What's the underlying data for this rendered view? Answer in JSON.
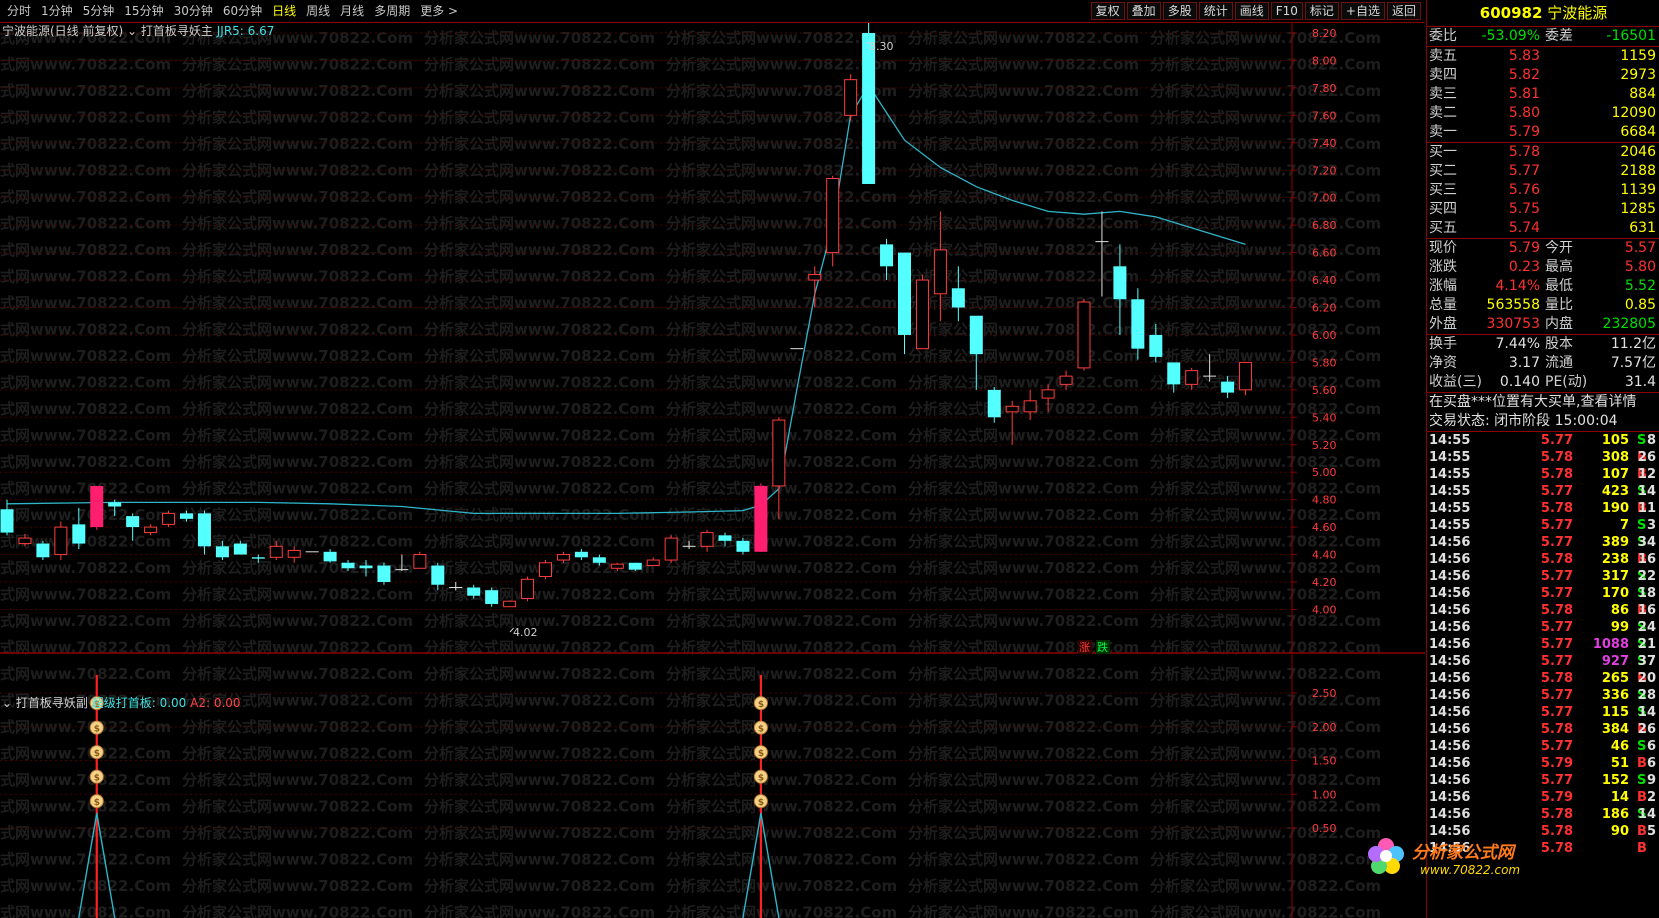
{
  "toolbar": {
    "periods": [
      "分时",
      "1分钟",
      "5分钟",
      "15分钟",
      "30分钟",
      "60分钟",
      "日线",
      "周线",
      "月线",
      "多周期",
      "更多 >"
    ],
    "active_period": "日线",
    "tools": [
      "复权",
      "叠加",
      "多股",
      "统计",
      "画线",
      "F10",
      "标记",
      "+自选",
      "返回"
    ]
  },
  "main_chart": {
    "stock_label": "宁波能源(日线 前复权)",
    "indicator_name": "打首板寻妖主",
    "ma_label": "JJR5: 6.67",
    "y_ticks": [
      "8.20",
      "8.00",
      "7.80",
      "7.60",
      "7.40",
      "7.20",
      "7.00",
      "6.80",
      "6.60",
      "6.40",
      "6.20",
      "6.00",
      "5.80",
      "5.60",
      "5.40",
      "5.20",
      "5.00",
      "4.80",
      "4.60",
      "4.40",
      "4.20",
      "4.00"
    ],
    "high_annotation": "8.30",
    "low_annotation": "4.02",
    "marker_up": "涨",
    "marker_down": "跌"
  },
  "sub_chart": {
    "indicator_name": "打首板寻妖副",
    "line1": "超级打首板: 0.00",
    "line2": "A2: 0.00",
    "y_ticks": [
      "2.50",
      "2.00",
      "1.50",
      "1.00",
      "0.50"
    ]
  },
  "chart_data": {
    "type": "candlestick",
    "ylim": [
      3.95,
      8.35
    ],
    "candles": [
      [
        4.73,
        4.56,
        4.8,
        4.54
      ],
      [
        4.48,
        4.52,
        4.55,
        4.46
      ],
      [
        4.48,
        4.38,
        4.5,
        4.36
      ],
      [
        4.4,
        4.6,
        4.64,
        4.36
      ],
      [
        4.62,
        4.48,
        4.74,
        4.44
      ],
      [
        4.6,
        4.9,
        4.9,
        4.58
      ],
      [
        4.78,
        4.75,
        4.8,
        4.68
      ],
      [
        4.68,
        4.6,
        4.7,
        4.5
      ],
      [
        4.56,
        4.6,
        4.62,
        4.54
      ],
      [
        4.62,
        4.7,
        4.72,
        4.6
      ],
      [
        4.7,
        4.66,
        4.72,
        4.64
      ],
      [
        4.7,
        4.46,
        4.72,
        4.4
      ],
      [
        4.46,
        4.38,
        4.5,
        4.36
      ],
      [
        4.48,
        4.4,
        4.5,
        4.4
      ],
      [
        4.38,
        4.37,
        4.4,
        4.34
      ],
      [
        4.38,
        4.46,
        4.5,
        4.36
      ],
      [
        4.38,
        4.43,
        4.46,
        4.34
      ],
      [
        4.42,
        4.42,
        4.42,
        4.42
      ],
      [
        4.42,
        4.35,
        4.44,
        4.34
      ],
      [
        4.34,
        4.3,
        4.36,
        4.28
      ],
      [
        4.32,
        4.3,
        4.36,
        4.24
      ],
      [
        4.32,
        4.2,
        4.34,
        4.18
      ],
      [
        4.29,
        4.29,
        4.4,
        4.28
      ],
      [
        4.3,
        4.4,
        4.42,
        4.3
      ],
      [
        4.32,
        4.18,
        4.34,
        4.14
      ],
      [
        4.16,
        4.16,
        4.2,
        4.14
      ],
      [
        4.16,
        4.1,
        4.18,
        4.08
      ],
      [
        4.14,
        4.04,
        4.16,
        4.02
      ],
      [
        4.02,
        4.06,
        4.06,
        4.02
      ],
      [
        4.08,
        4.22,
        4.24,
        4.06
      ],
      [
        4.24,
        4.34,
        4.36,
        4.22
      ],
      [
        4.36,
        4.4,
        4.42,
        4.34
      ],
      [
        4.42,
        4.38,
        4.44,
        4.36
      ],
      [
        4.38,
        4.34,
        4.4,
        4.32
      ],
      [
        4.3,
        4.33,
        4.34,
        4.28
      ],
      [
        4.34,
        4.29,
        4.34,
        4.28
      ],
      [
        4.32,
        4.36,
        4.38,
        4.32
      ],
      [
        4.36,
        4.52,
        4.54,
        4.34
      ],
      [
        4.46,
        4.46,
        4.5,
        4.44
      ],
      [
        4.46,
        4.56,
        4.58,
        4.42
      ],
      [
        4.54,
        4.5,
        4.56,
        4.46
      ],
      [
        4.5,
        4.42,
        4.52,
        4.4
      ],
      [
        4.42,
        4.9,
        4.92,
        4.42
      ],
      [
        4.9,
        5.38,
        5.4,
        4.66
      ],
      [
        5.9,
        5.9,
        5.9,
        5.9
      ],
      [
        6.4,
        6.44,
        6.5,
        6.2
      ],
      [
        6.6,
        7.14,
        7.16,
        6.5
      ],
      [
        7.6,
        7.86,
        7.9,
        7.56
      ],
      [
        8.2,
        7.1,
        8.3,
        7.1
      ],
      [
        6.66,
        6.5,
        6.7,
        6.4
      ],
      [
        6.6,
        6.0,
        6.6,
        5.86
      ],
      [
        5.9,
        6.4,
        6.44,
        5.9
      ],
      [
        6.3,
        6.62,
        6.9,
        6.1
      ],
      [
        6.34,
        6.2,
        6.5,
        6.1
      ],
      [
        6.14,
        5.86,
        6.12,
        5.6
      ],
      [
        5.6,
        5.4,
        5.62,
        5.36
      ],
      [
        5.44,
        5.48,
        5.52,
        5.2
      ],
      [
        5.44,
        5.52,
        5.6,
        5.38
      ],
      [
        5.54,
        5.6,
        5.64,
        5.44
      ],
      [
        5.64,
        5.7,
        5.74,
        5.6
      ],
      [
        5.76,
        6.24,
        6.26,
        5.74
      ],
      [
        6.68,
        6.68,
        6.9,
        6.28
      ],
      [
        6.5,
        6.26,
        6.66,
        6.0
      ],
      [
        6.26,
        5.9,
        6.34,
        5.82
      ],
      [
        6.0,
        5.84,
        6.08,
        5.8
      ],
      [
        5.8,
        5.64,
        5.8,
        5.58
      ],
      [
        5.64,
        5.74,
        5.76,
        5.6
      ],
      [
        5.7,
        5.7,
        5.86,
        5.66
      ],
      [
        5.66,
        5.58,
        5.7,
        5.54
      ],
      [
        5.6,
        5.8,
        5.8,
        5.56
      ]
    ],
    "special_days": [
      5,
      42
    ],
    "ma": [
      [
        0,
        4.77
      ],
      [
        6,
        4.78
      ],
      [
        10,
        4.78
      ],
      [
        14,
        4.78
      ],
      [
        18,
        4.77
      ],
      [
        22,
        4.75
      ],
      [
        26,
        4.7
      ],
      [
        30,
        4.7
      ],
      [
        34,
        4.7
      ],
      [
        38,
        4.71
      ],
      [
        41,
        4.72
      ],
      [
        42,
        4.76
      ],
      [
        43,
        4.88
      ],
      [
        44,
        5.6
      ],
      [
        45,
        6.3
      ],
      [
        46,
        6.8
      ],
      [
        47,
        7.6
      ],
      [
        48,
        7.82
      ],
      [
        49,
        7.62
      ],
      [
        50,
        7.42
      ],
      [
        52,
        7.22
      ],
      [
        54,
        7.08
      ],
      [
        56,
        6.98
      ],
      [
        58,
        6.9
      ],
      [
        60,
        6.88
      ],
      [
        62,
        6.9
      ],
      [
        64,
        6.86
      ],
      [
        66,
        6.78
      ],
      [
        68,
        6.7
      ],
      [
        69,
        6.66
      ]
    ]
  },
  "panel": {
    "code": "600982",
    "name": "宁波能源",
    "weibi": {
      "label": "委比",
      "value": "-53.09%",
      "label2": "委差",
      "value2": "-16501"
    },
    "sells": [
      {
        "label": "卖五",
        "price": "5.83",
        "vol": "1159"
      },
      {
        "label": "卖四",
        "price": "5.82",
        "vol": "2973"
      },
      {
        "label": "卖三",
        "price": "5.81",
        "vol": "884"
      },
      {
        "label": "卖二",
        "price": "5.80",
        "vol": "12090"
      },
      {
        "label": "卖一",
        "price": "5.79",
        "vol": "6684"
      }
    ],
    "buys": [
      {
        "label": "买一",
        "price": "5.78",
        "vol": "2046"
      },
      {
        "label": "买二",
        "price": "5.77",
        "vol": "2188"
      },
      {
        "label": "买三",
        "price": "5.76",
        "vol": "1139"
      },
      {
        "label": "买四",
        "price": "5.75",
        "vol": "1285"
      },
      {
        "label": "买五",
        "price": "5.74",
        "vol": "631"
      }
    ],
    "quote": [
      {
        "l1": "现价",
        "v1": "5.79",
        "c1": "rr",
        "l2": "今开",
        "v2": "5.57",
        "c2": "rr"
      },
      {
        "l1": "涨跌",
        "v1": "0.23",
        "c1": "rr",
        "l2": "最高",
        "v2": "5.80",
        "c2": "rr"
      },
      {
        "l1": "涨幅",
        "v1": "4.14%",
        "c1": "rr",
        "l2": "最低",
        "v2": "5.52",
        "c2": "g"
      },
      {
        "l1": "总量",
        "v1": "563558",
        "c1": "y",
        "l2": "量比",
        "v2": "0.85",
        "c2": "y"
      },
      {
        "l1": "外盘",
        "v1": "330753",
        "c1": "rr",
        "l2": "内盘",
        "v2": "232805",
        "c2": "g"
      }
    ],
    "fund": [
      {
        "l1": "换手",
        "v1": "7.44%",
        "l2": "股本",
        "v2": "11.2亿"
      },
      {
        "l1": "净资",
        "v1": "3.17",
        "l2": "流通",
        "v2": "7.57亿"
      },
      {
        "l1": "收益(三)",
        "v1": "0.140",
        "l2": "PE(动)",
        "v2": "31.4"
      }
    ],
    "notice": "在买盘***位置有大买单,查看详情",
    "trade_state_label": "交易状态: 闭市阶段",
    "trade_state_time": "15:00:04",
    "ticks": [
      [
        "14:55",
        "5.77",
        "105",
        "S",
        "8"
      ],
      [
        "14:55",
        "5.78",
        "308",
        "B",
        "26"
      ],
      [
        "14:55",
        "5.78",
        "107",
        "B",
        "12"
      ],
      [
        "14:55",
        "5.77",
        "423",
        "S",
        "14"
      ],
      [
        "14:55",
        "5.78",
        "190",
        "B",
        "11"
      ],
      [
        "14:55",
        "5.77",
        "7",
        "S",
        "3"
      ],
      [
        "14:56",
        "5.77",
        "389",
        "S",
        "34"
      ],
      [
        "14:56",
        "5.78",
        "238",
        "B",
        "16"
      ],
      [
        "14:56",
        "5.77",
        "317",
        "S",
        "22"
      ],
      [
        "14:56",
        "5.77",
        "170",
        "S",
        "18"
      ],
      [
        "14:56",
        "5.78",
        "86",
        "B",
        "16"
      ],
      [
        "14:56",
        "5.77",
        "99",
        "S",
        "24"
      ],
      [
        "14:56",
        "5.77",
        "1088",
        "S",
        "21"
      ],
      [
        "14:56",
        "5.77",
        "927",
        "S",
        "37"
      ],
      [
        "14:56",
        "5.78",
        "265",
        "B",
        "20"
      ],
      [
        "14:56",
        "5.77",
        "336",
        "S",
        "28"
      ],
      [
        "14:56",
        "5.77",
        "115",
        "S",
        "14"
      ],
      [
        "14:56",
        "5.78",
        "384",
        "B",
        "26"
      ],
      [
        "14:56",
        "5.77",
        "46",
        "S",
        "6"
      ],
      [
        "14:56",
        "5.79",
        "51",
        "B",
        "6"
      ],
      [
        "14:56",
        "5.77",
        "152",
        "S",
        "9"
      ],
      [
        "14:56",
        "5.79",
        "14",
        "B",
        "2"
      ],
      [
        "14:56",
        "5.78",
        "186",
        "S",
        "14"
      ],
      [
        "14:56",
        "5.78",
        "90",
        "B",
        "5"
      ],
      [
        "14:56",
        "5.78",
        "",
        "B",
        ""
      ]
    ]
  },
  "watermark": {
    "text": "分析家公式网www.70822.Com",
    "logo_main": "分析家公式网",
    "logo_url": "www.70822.com"
  },
  "colors": {
    "up": "#ff3c3c",
    "down": "#54ffff",
    "special": "#ff1f6e",
    "ma": "#2fb5c8",
    "grid": "#4a0000",
    "accent": "#ffff00"
  }
}
